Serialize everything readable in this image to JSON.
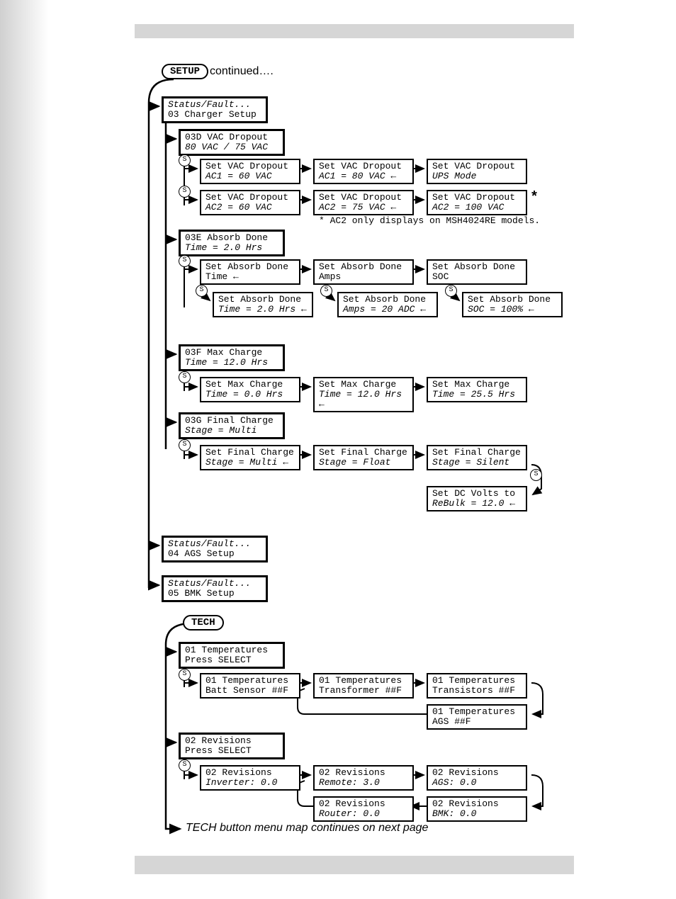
{
  "header": {
    "setup_pill": "SETUP",
    "continued": "continued….",
    "tech_pill": "TECH"
  },
  "setup": {
    "charger_setup": {
      "l1": "Status/Fault...",
      "l2": "03 Charger Setup"
    },
    "vac_dropout_hdr": {
      "l1": "03D VAC Dropout",
      "l2": "80 VAC / 75 VAC"
    },
    "vac_ac1_60": {
      "l1": "Set VAC Dropout",
      "l2": "AC1 =  60 VAC"
    },
    "vac_ac1_80": {
      "l1": "Set VAC Dropout",
      "l2": "AC1 =  80 VAC  ←"
    },
    "vac_ac1_ups": {
      "l1": "Set VAC Dropout",
      "l2": "UPS Mode"
    },
    "vac_ac2_60": {
      "l1": "Set VAC Dropout",
      "l2": "AC2 =  60 VAC"
    },
    "vac_ac2_75": {
      "l1": "Set VAC Dropout",
      "l2": "AC2 =  75 VAC  ←"
    },
    "vac_ac2_100": {
      "l1": "Set VAC Dropout",
      "l2": "AC2 = 100 VAC"
    },
    "ac2_note": "* AC2 only displays on MSH4024RE models.",
    "absorb_hdr": {
      "l1": "03E Absorb Done",
      "l2": "Time =  2.0 Hrs"
    },
    "absorb_time": {
      "l1": "Set Absorb Done",
      "l2": "Time          ←"
    },
    "absorb_amps": {
      "l1": "Set Absorb Done",
      "l2": "Amps"
    },
    "absorb_soc": {
      "l1": "Set Absorb Done",
      "l2": "SOC"
    },
    "absorb_time_v": {
      "l1": "Set Absorb Done",
      "l2": "Time =  2.0 Hrs ←"
    },
    "absorb_amps_v": {
      "l1": "Set Absorb Done",
      "l2": "Amps =  20 ADC ←"
    },
    "absorb_soc_v": {
      "l1": "Set Absorb Done",
      "l2": "SOC = 100%    ←"
    },
    "maxcharge_hdr": {
      "l1": "03F Max Charge",
      "l2": "Time = 12.0 Hrs"
    },
    "maxcharge_0": {
      "l1": "Set Max Charge",
      "l2": "Time =  0.0 Hrs"
    },
    "maxcharge_12": {
      "l1": "Set Max Charge",
      "l2": "Time = 12.0 Hrs ←"
    },
    "maxcharge_25": {
      "l1": "Set Max Charge",
      "l2": "Time = 25.5 Hrs"
    },
    "final_hdr": {
      "l1": "03G Final Charge",
      "l2": "Stage = Multi"
    },
    "final_multi": {
      "l1": "Set Final Charge",
      "l2": "Stage = Multi  ←"
    },
    "final_float": {
      "l1": "Set Final Charge",
      "l2": "Stage = Float"
    },
    "final_silent": {
      "l1": "Set Final Charge",
      "l2": "Stage = Silent"
    },
    "dc_rebulk": {
      "l1": "Set DC Volts to",
      "l2": "ReBulk =  12.0 ←"
    },
    "ags_setup": {
      "l1": "Status/Fault...",
      "l2": "04 AGS Setup"
    },
    "bmk_setup": {
      "l1": "Status/Fault...",
      "l2": "05 BMK Setup"
    }
  },
  "tech": {
    "temp_hdr": {
      "l1": "01 Temperatures",
      "l2": " Press SELECT"
    },
    "temp_batt": {
      "l1": "01 Temperatures",
      "l2": "Batt Sensor  ##F"
    },
    "temp_xfmr": {
      "l1": "01 Temperatures",
      "l2": "Transformer  ##F"
    },
    "temp_trans": {
      "l1": "01 Temperatures",
      "l2": "Transistors  ##F"
    },
    "temp_ags": {
      "l1": "01 Temperatures",
      "l2": "AGS          ##F"
    },
    "rev_hdr": {
      "l1": "02 Revisions",
      "l2": " Press SELECT"
    },
    "rev_inv": {
      "l1": "02 Revisions",
      "l2": "Inverter:  0.0"
    },
    "rev_rem": {
      "l1": "02 Revisions",
      "l2": "Remote:    3.0"
    },
    "rev_ags": {
      "l1": "02 Revisions",
      "l2": "AGS:       0.0"
    },
    "rev_rtr": {
      "l1": "02 Revisions",
      "l2": "Router:    0.0"
    },
    "rev_bmk": {
      "l1": "02 Revisions",
      "l2": "BMK:       0.0"
    }
  },
  "footer": {
    "continue_text": "TECH button menu map continues on next page"
  }
}
